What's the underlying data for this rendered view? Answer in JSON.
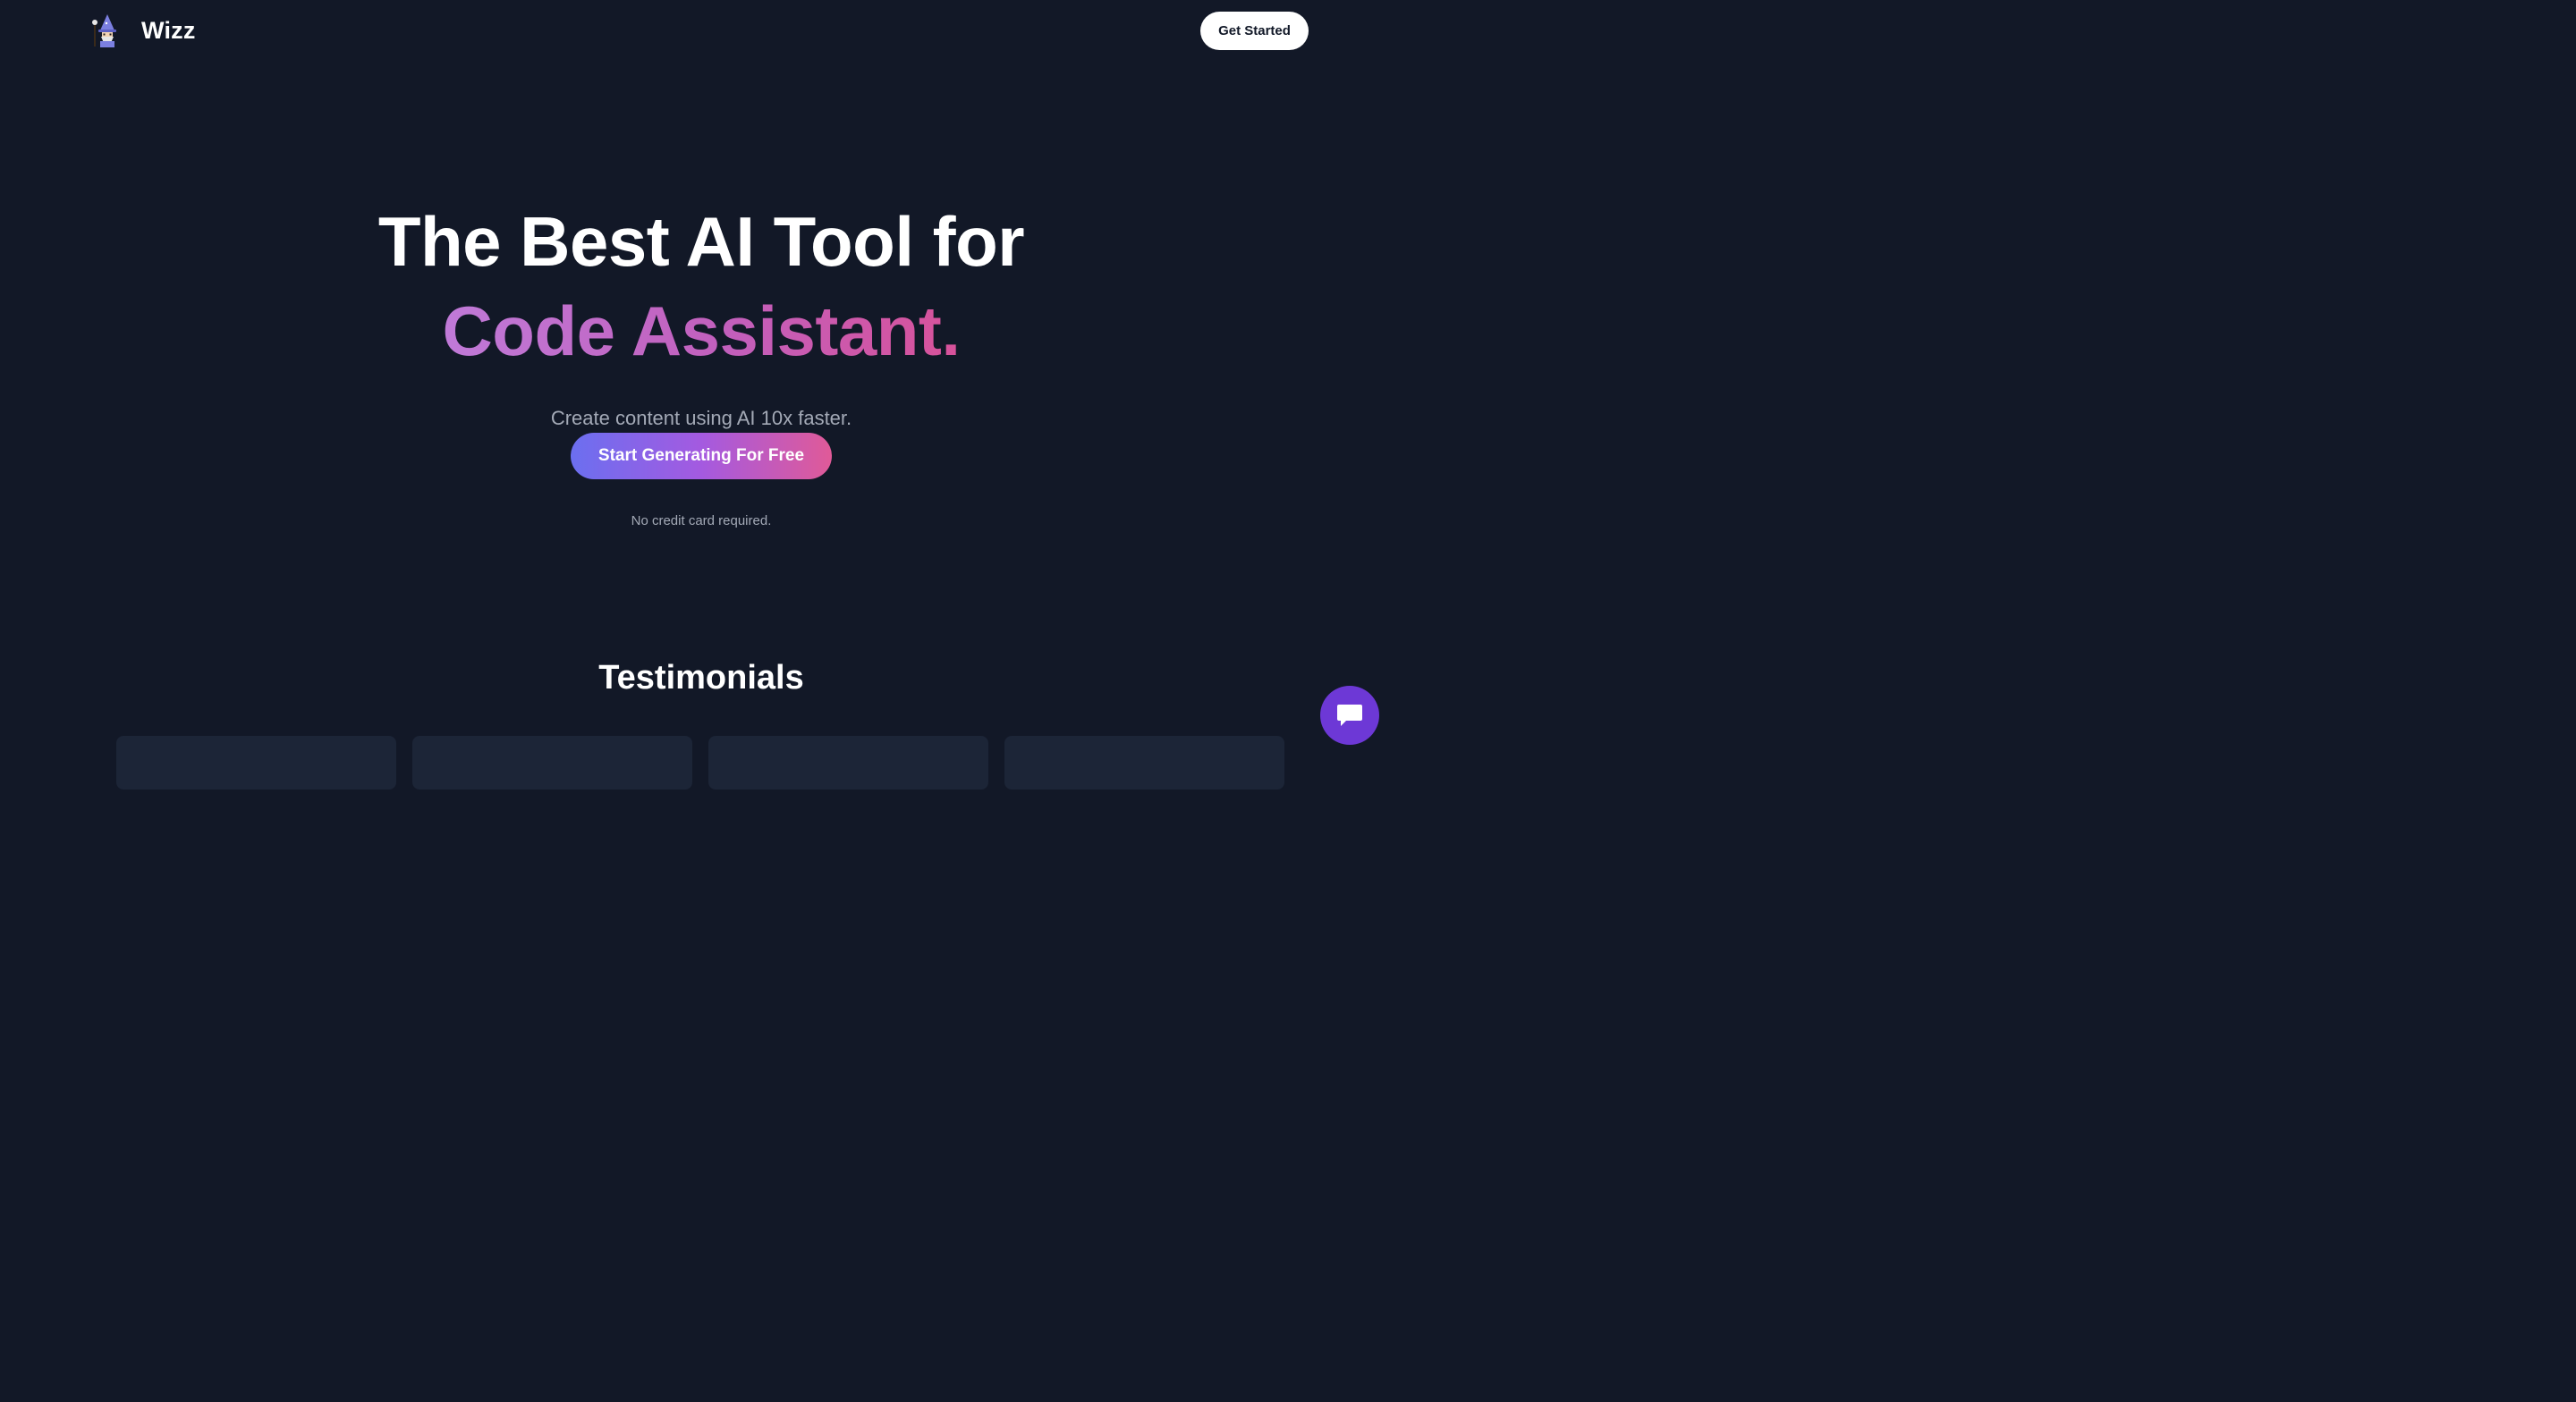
{
  "header": {
    "brand": "Wizz",
    "cta_label": "Get Started"
  },
  "hero": {
    "line1": "The Best AI Tool for",
    "line2": "Code Assistant.",
    "subtitle": "Create content using AI 10x faster.",
    "cta_label": "Start Generating For Free",
    "note": "No credit card required."
  },
  "testimonials": {
    "heading": "Testimonials",
    "card_count_visible": 4
  },
  "icons": {
    "logo": "wizard-icon",
    "chat": "chat-bubble-icon"
  },
  "colors": {
    "background": "#121827",
    "card": "#1c2537",
    "gradient_start": "#6b6ff0",
    "gradient_end": "#e05a98",
    "headline_gradient_start": "#c07ad8",
    "headline_gradient_end": "#d8529a",
    "chat_button": "#6d38d6",
    "muted_text": "#a3a9b6"
  }
}
